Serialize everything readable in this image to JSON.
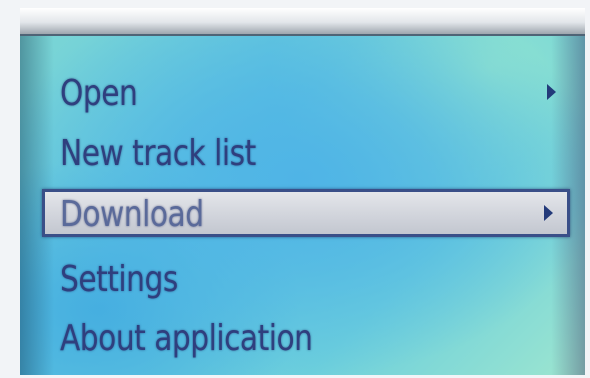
{
  "menu": {
    "items": [
      {
        "label": "Open",
        "has_submenu": true,
        "selected": false
      },
      {
        "label": "New track list",
        "has_submenu": false,
        "selected": false
      },
      {
        "label": "Download",
        "has_submenu": true,
        "selected": true
      },
      {
        "label": "Settings",
        "has_submenu": false,
        "selected": false
      },
      {
        "label": "About application",
        "has_submenu": false,
        "selected": false
      }
    ]
  },
  "icons": {
    "submenu": "chevron-right-icon"
  },
  "colors": {
    "text": "#2f3f7e",
    "selection_background": "#d3d6dd",
    "selection_border": "#3a4f88",
    "screen_background": "#5cc3e0"
  }
}
